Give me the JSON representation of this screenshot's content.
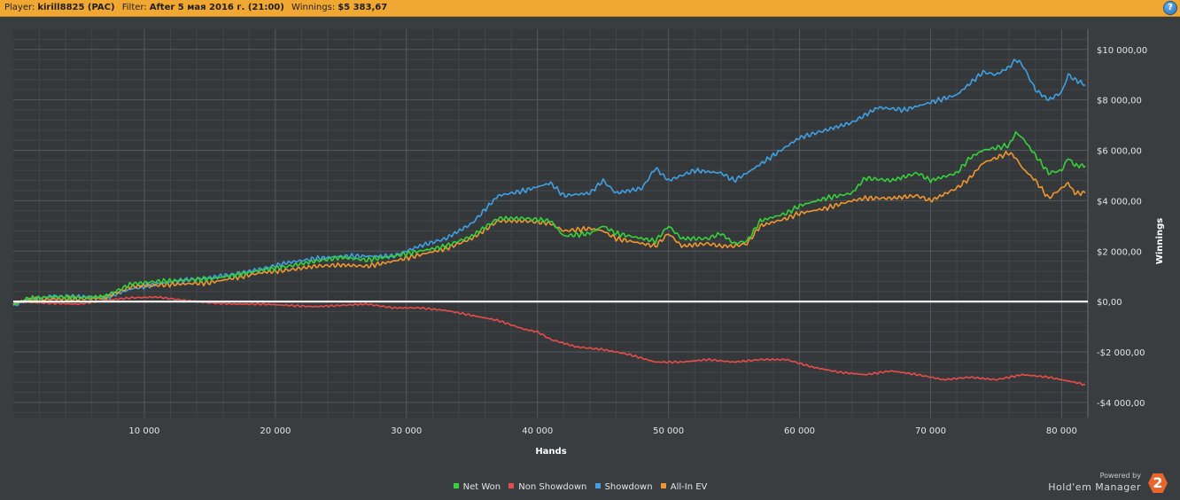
{
  "header": {
    "player_label": "Player:",
    "player_value": "kirill8825 (PAC)",
    "filter_label": "Filter:",
    "filter_value": "After 5 мая 2016 г. (21:00)",
    "winnings_label": "Winnings:",
    "winnings_value": "$5 383,67",
    "help_glyph": "?",
    "icon": "help-icon"
  },
  "branding": {
    "powered": "Powered by",
    "product": "Hold'em Manager",
    "logo_text": "2"
  },
  "chart_data": {
    "type": "line",
    "xlabel": "Hands",
    "ylabel": "Winnings",
    "xlim": [
      0,
      82000
    ],
    "ylim": [
      -4600,
      10800
    ],
    "x_ticks": [
      10000,
      20000,
      30000,
      40000,
      50000,
      60000,
      70000,
      80000
    ],
    "x_tick_labels": [
      "10 000",
      "20 000",
      "30 000",
      "40 000",
      "50 000",
      "60 000",
      "70 000",
      "80 000"
    ],
    "y_ticks": [
      -4000,
      -2000,
      0,
      2000,
      4000,
      6000,
      8000,
      10000
    ],
    "y_tick_labels": [
      "-$4 000,00",
      "-$2 000,00",
      "$0,00",
      "$2 000,00",
      "$4 000,00",
      "$6 000,00",
      "$8 000,00",
      "$10 000,00"
    ],
    "grid": true,
    "legend_position": "bottom-center",
    "zero_line_color": "#ffffff",
    "series": [
      {
        "name": "Net Won",
        "color": "#35d23a",
        "points": [
          [
            0,
            -150
          ],
          [
            1000,
            100
          ],
          [
            3000,
            200
          ],
          [
            5000,
            150
          ],
          [
            7000,
            200
          ],
          [
            9000,
            700
          ],
          [
            11000,
            800
          ],
          [
            13000,
            850
          ],
          [
            15000,
            900
          ],
          [
            17000,
            1050
          ],
          [
            19000,
            1250
          ],
          [
            21000,
            1400
          ],
          [
            23000,
            1600
          ],
          [
            25000,
            1750
          ],
          [
            27000,
            1650
          ],
          [
            29000,
            1800
          ],
          [
            31000,
            2000
          ],
          [
            33000,
            2200
          ],
          [
            35000,
            2600
          ],
          [
            37000,
            3300
          ],
          [
            39000,
            3300
          ],
          [
            40000,
            3250
          ],
          [
            41000,
            3200
          ],
          [
            42000,
            2600
          ],
          [
            44000,
            2700
          ],
          [
            45000,
            3000
          ],
          [
            46000,
            2700
          ],
          [
            48000,
            2500
          ],
          [
            49000,
            2400
          ],
          [
            50000,
            3000
          ],
          [
            51000,
            2500
          ],
          [
            53000,
            2500
          ],
          [
            54000,
            2700
          ],
          [
            55000,
            2300
          ],
          [
            56000,
            2400
          ],
          [
            57000,
            3200
          ],
          [
            59000,
            3500
          ],
          [
            60000,
            3800
          ],
          [
            62000,
            4100
          ],
          [
            64000,
            4300
          ],
          [
            65000,
            4900
          ],
          [
            67000,
            4800
          ],
          [
            69000,
            5100
          ],
          [
            70000,
            4800
          ],
          [
            72000,
            5100
          ],
          [
            73000,
            5700
          ],
          [
            74000,
            6000
          ],
          [
            75000,
            6100
          ],
          [
            76000,
            6200
          ],
          [
            76500,
            6700
          ],
          [
            77000,
            6500
          ],
          [
            78000,
            5800
          ],
          [
            79000,
            5100
          ],
          [
            80000,
            5200
          ],
          [
            80500,
            5700
          ],
          [
            81000,
            5400
          ],
          [
            81800,
            5380
          ]
        ]
      },
      {
        "name": "Non Showdown",
        "color": "#e94b4b",
        "points": [
          [
            0,
            0
          ],
          [
            2000,
            -50
          ],
          [
            5000,
            -100
          ],
          [
            7000,
            50
          ],
          [
            9000,
            150
          ],
          [
            11000,
            180
          ],
          [
            13000,
            50
          ],
          [
            15000,
            -50
          ],
          [
            17000,
            -100
          ],
          [
            19000,
            -100
          ],
          [
            21000,
            -150
          ],
          [
            23000,
            -200
          ],
          [
            25000,
            -150
          ],
          [
            27000,
            -100
          ],
          [
            29000,
            -250
          ],
          [
            31000,
            -250
          ],
          [
            33000,
            -350
          ],
          [
            35000,
            -550
          ],
          [
            37000,
            -750
          ],
          [
            39000,
            -1100
          ],
          [
            40000,
            -1200
          ],
          [
            41000,
            -1500
          ],
          [
            43000,
            -1800
          ],
          [
            45000,
            -1900
          ],
          [
            47000,
            -2100
          ],
          [
            49000,
            -2400
          ],
          [
            51000,
            -2400
          ],
          [
            53000,
            -2300
          ],
          [
            55000,
            -2400
          ],
          [
            57000,
            -2300
          ],
          [
            59000,
            -2300
          ],
          [
            61000,
            -2600
          ],
          [
            63000,
            -2800
          ],
          [
            65000,
            -2900
          ],
          [
            67000,
            -2750
          ],
          [
            69000,
            -2900
          ],
          [
            71000,
            -3100
          ],
          [
            73000,
            -3000
          ],
          [
            75000,
            -3100
          ],
          [
            77000,
            -2900
          ],
          [
            79000,
            -3000
          ],
          [
            81000,
            -3200
          ],
          [
            81800,
            -3300
          ]
        ]
      },
      {
        "name": "Showdown",
        "color": "#3fa0e4",
        "points": [
          [
            0,
            -150
          ],
          [
            1000,
            50
          ],
          [
            3000,
            200
          ],
          [
            5000,
            200
          ],
          [
            7000,
            150
          ],
          [
            9000,
            500
          ],
          [
            11000,
            700
          ],
          [
            13000,
            850
          ],
          [
            15000,
            950
          ],
          [
            17000,
            1100
          ],
          [
            19000,
            1300
          ],
          [
            21000,
            1550
          ],
          [
            23000,
            1700
          ],
          [
            25000,
            1800
          ],
          [
            27000,
            1800
          ],
          [
            29000,
            1800
          ],
          [
            31000,
            2200
          ],
          [
            33000,
            2500
          ],
          [
            35000,
            3100
          ],
          [
            37000,
            4200
          ],
          [
            39000,
            4400
          ],
          [
            41000,
            4700
          ],
          [
            42000,
            4200
          ],
          [
            44000,
            4300
          ],
          [
            45000,
            4800
          ],
          [
            46000,
            4300
          ],
          [
            48000,
            4500
          ],
          [
            49000,
            5300
          ],
          [
            50000,
            4800
          ],
          [
            52000,
            5200
          ],
          [
            54000,
            5100
          ],
          [
            55000,
            4800
          ],
          [
            56000,
            5100
          ],
          [
            58000,
            5800
          ],
          [
            60000,
            6500
          ],
          [
            62000,
            6800
          ],
          [
            64000,
            7100
          ],
          [
            66000,
            7700
          ],
          [
            68000,
            7600
          ],
          [
            70000,
            7900
          ],
          [
            72000,
            8200
          ],
          [
            74000,
            9100
          ],
          [
            75000,
            9000
          ],
          [
            76000,
            9300
          ],
          [
            76500,
            9600
          ],
          [
            77000,
            9400
          ],
          [
            78000,
            8400
          ],
          [
            79000,
            8000
          ],
          [
            80000,
            8300
          ],
          [
            80500,
            9000
          ],
          [
            81000,
            8800
          ],
          [
            81800,
            8600
          ]
        ]
      },
      {
        "name": "All-In EV",
        "color": "#f0962e",
        "points": [
          [
            0,
            -100
          ],
          [
            1000,
            50
          ],
          [
            3000,
            100
          ],
          [
            5000,
            100
          ],
          [
            7000,
            150
          ],
          [
            9000,
            600
          ],
          [
            11000,
            650
          ],
          [
            13000,
            700
          ],
          [
            15000,
            750
          ],
          [
            17000,
            950
          ],
          [
            19000,
            1150
          ],
          [
            21000,
            1250
          ],
          [
            23000,
            1400
          ],
          [
            25000,
            1450
          ],
          [
            27000,
            1400
          ],
          [
            29000,
            1600
          ],
          [
            31000,
            1850
          ],
          [
            33000,
            2100
          ],
          [
            35000,
            2500
          ],
          [
            37000,
            3200
          ],
          [
            39000,
            3200
          ],
          [
            41000,
            3100
          ],
          [
            42000,
            2800
          ],
          [
            44000,
            2900
          ],
          [
            45000,
            2800
          ],
          [
            46000,
            2500
          ],
          [
            48000,
            2300
          ],
          [
            49000,
            2200
          ],
          [
            50000,
            2700
          ],
          [
            51000,
            2200
          ],
          [
            53000,
            2300
          ],
          [
            54000,
            2200
          ],
          [
            55000,
            2200
          ],
          [
            56000,
            2300
          ],
          [
            57000,
            3000
          ],
          [
            59000,
            3300
          ],
          [
            60000,
            3500
          ],
          [
            62000,
            3700
          ],
          [
            64000,
            4000
          ],
          [
            65000,
            4100
          ],
          [
            67000,
            4100
          ],
          [
            69000,
            4200
          ],
          [
            70000,
            4000
          ],
          [
            72000,
            4500
          ],
          [
            73000,
            4900
          ],
          [
            74000,
            5500
          ],
          [
            75000,
            5700
          ],
          [
            76000,
            5900
          ],
          [
            76500,
            5700
          ],
          [
            77000,
            5300
          ],
          [
            78000,
            4800
          ],
          [
            79000,
            4100
          ],
          [
            80000,
            4500
          ],
          [
            80500,
            4700
          ],
          [
            81000,
            4300
          ],
          [
            81800,
            4300
          ]
        ]
      }
    ]
  }
}
